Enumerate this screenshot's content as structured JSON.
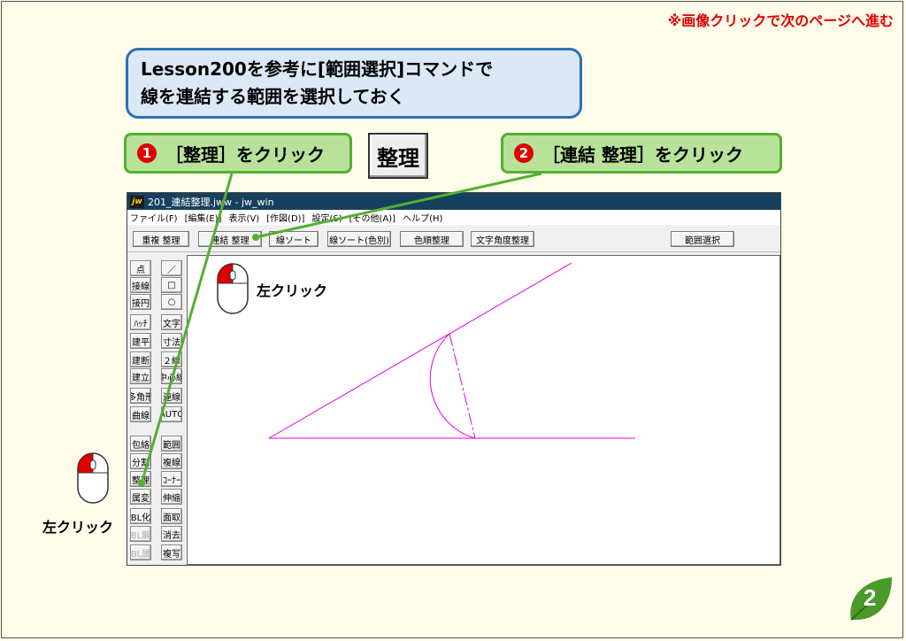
{
  "nav_hint": "※画像クリックで次のページへ進む",
  "callout": {
    "line1": "Lesson200を参考に[範囲選択]コマンドで",
    "line2": "線を連結する範囲を選択しておく"
  },
  "steps": [
    {
      "num": "1",
      "text": "［整理］をクリック"
    },
    {
      "num": "2",
      "text": "［連結 整理］をクリック"
    }
  ],
  "big_button_label": "整理",
  "window": {
    "title": "201_連結整理.jww - jw_win",
    "app_icon": "jw",
    "menu": [
      "ファイル(F)",
      "[編集(E)]",
      "表示(V)",
      "[作図(D)]",
      "設定(S)",
      "[その他(A)]",
      "ヘルプ(H)"
    ]
  },
  "toolbar": [
    "重複 整理",
    "連結 整理",
    "線ソート",
    "線ソート(色別)",
    "色順整理",
    "文字角度整理",
    "範囲選択"
  ],
  "left_tools": {
    "col1": [
      "点",
      "接線",
      "接円",
      "ﾊｯﾁ",
      "建平",
      "建断",
      "建立",
      "多角形",
      "曲線",
      "包絡",
      "分割",
      "整理",
      "属変",
      "BL化",
      "BL解",
      "BL属"
    ],
    "col2": [
      "／",
      "□",
      "○",
      "文字",
      "寸法",
      "２線",
      "中心線",
      "連線",
      "AUTO",
      "範囲",
      "複線",
      "ｺｰﾅｰ",
      "伸縮",
      "面取",
      "消去",
      "複写"
    ],
    "dim": [
      "BL解",
      "BL属"
    ]
  },
  "mouse_labels": [
    "左クリック",
    "左クリック"
  ],
  "page_number": "2",
  "colors": {
    "callout_bg": "#dbe9f7",
    "callout_border": "#2f6fb5",
    "step_bg": "#b8e29a",
    "step_border": "#53b030",
    "nav_hint": "#e00000",
    "drawing_line": "#e000e0",
    "leaf": "#4a9a2a"
  }
}
